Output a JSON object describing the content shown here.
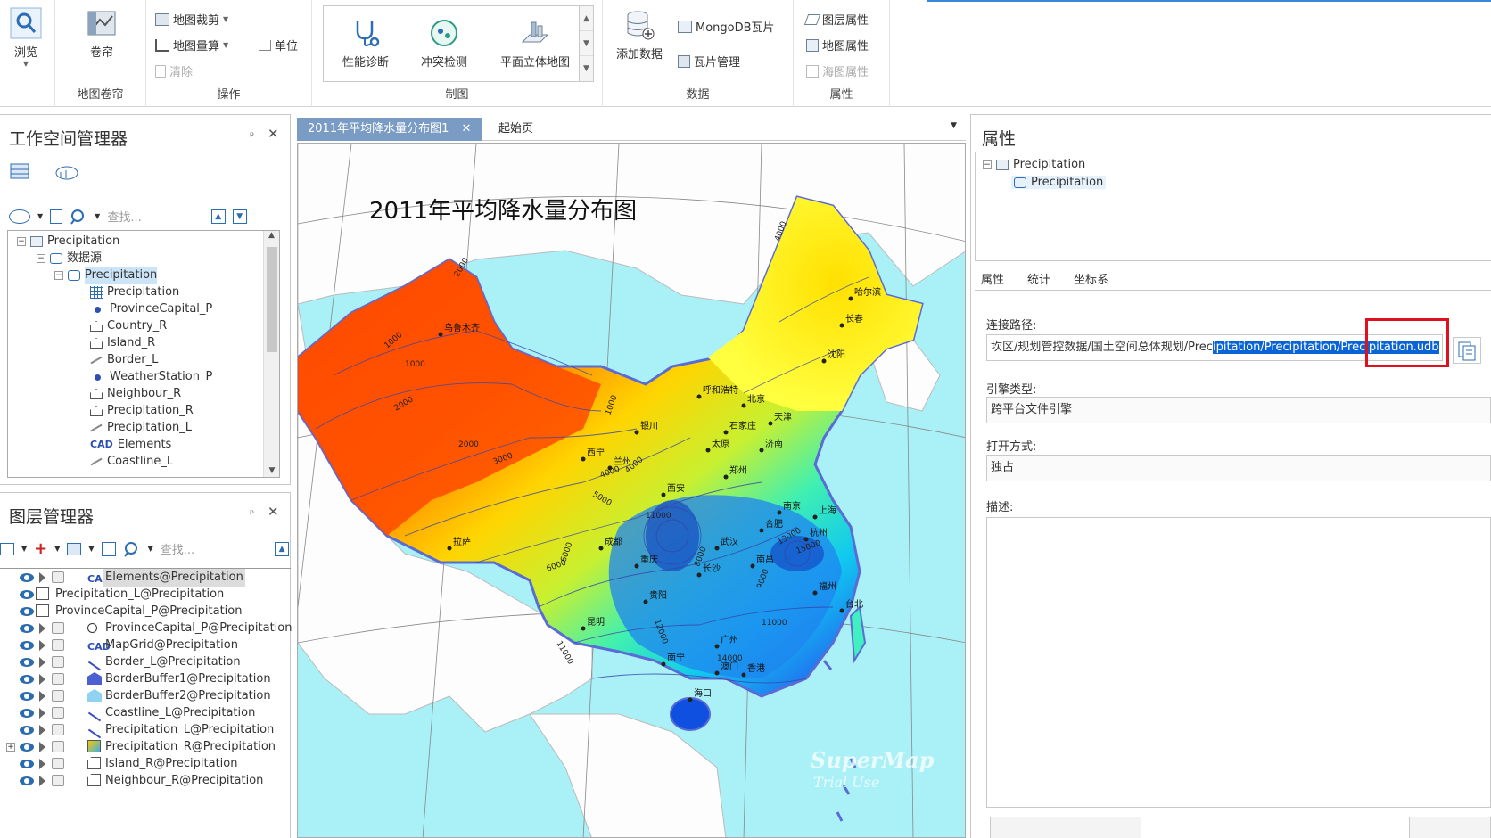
{
  "ribbon": {
    "groups": {
      "browse": {
        "label": "浏览"
      },
      "mapreel": {
        "btn": "卷帘",
        "label": "地图卷帘"
      },
      "operation": {
        "clip": "地图裁剪",
        "measure": "地图量算",
        "unit": "单位",
        "clear": "清除",
        "label": "操作"
      },
      "cartography": {
        "diag": "性能诊断",
        "conflict": "冲突检测",
        "flat3d": "平面立体地图",
        "label": "制图"
      },
      "data": {
        "add": "添加数据",
        "mongo": "MongoDB瓦片",
        "tile": "瓦片管理",
        "label": "数据"
      },
      "props": {
        "layer": "图层属性",
        "map": "地图属性",
        "chart": "海图属性",
        "label": "属性"
      }
    }
  },
  "workspace": {
    "title": "工作空间管理器",
    "search_placeholder": "查找...",
    "tree": [
      "Precipitation",
      "数据源",
      "Precipitation",
      "Precipitation",
      "ProvinceCapital_P",
      "Country_R",
      "Island_R",
      "Border_L",
      "WeatherStation_P",
      "Neighbour_R",
      "Precipitation_R",
      "Precipitation_L",
      "Elements",
      "Coastline_L"
    ]
  },
  "layers": {
    "title": "图层管理器",
    "search_placeholder": "查找...",
    "items": [
      "Elements@Precipitation",
      "Precipitation_L@Precipitation",
      "ProvinceCapital_P@Precipitation",
      "ProvinceCapital_P@Precipitation",
      "MapGrid@Precipitation",
      "Border_L@Precipitation",
      "BorderBuffer1@Precipitation",
      "BorderBuffer2@Precipitation",
      "Coastline_L@Precipitation",
      "Precipitation_L@Precipitation",
      "Precipitation_R@Precipitation",
      "Island_R@Precipitation",
      "Neighbour_R@Precipitation"
    ]
  },
  "doc_tabs": {
    "map": "2011年平均降水量分布图1",
    "start": "起始页"
  },
  "map": {
    "title": "2011年平均降水量分布图",
    "watermark1": "SuperMap",
    "watermark2": "Trial Use",
    "cities": [
      "乌鲁木齐",
      "哈尔滨",
      "长春",
      "沈阳",
      "呼和浩特",
      "北京",
      "天津",
      "银川",
      "石家庄",
      "太原",
      "济南",
      "西宁",
      "兰州",
      "郑州",
      "西安",
      "南京",
      "上海",
      "合肥",
      "拉萨",
      "成都",
      "武汉",
      "杭州",
      "重庆",
      "南昌",
      "长沙",
      "福州",
      "贵阳",
      "台北",
      "昆明",
      "广州",
      "南宁",
      "澳门",
      "香港",
      "海口"
    ],
    "contours": [
      "2000",
      "1000",
      "2000",
      "1000",
      "3000",
      "4000",
      "1000",
      "2000",
      "4000",
      "4000",
      "5000",
      "6000",
      "11000",
      "13000",
      "15000",
      "8000",
      "12000",
      "14000",
      "9000",
      "6000",
      "11000",
      "11000"
    ]
  },
  "properties": {
    "title": "属性",
    "tree": [
      "Precipitation",
      "Precipitation"
    ],
    "tabs": [
      "属性",
      "统计",
      "坐标系"
    ],
    "conn_label": "连接路径:",
    "conn_value_a": "坎区/规划管控数据/国土空间总体规划/Prec",
    "conn_value_b": "ipitation/Precipitation/Precipitation.udb",
    "engine_label": "引擎类型:",
    "engine_value": "跨平台文件引擎",
    "open_label": "打开方式:",
    "open_value": "独占",
    "desc_label": "描述:"
  },
  "colors": {
    "accent": "#3b86d9",
    "highlight": "#0a64d6",
    "red": "#e0101e"
  }
}
